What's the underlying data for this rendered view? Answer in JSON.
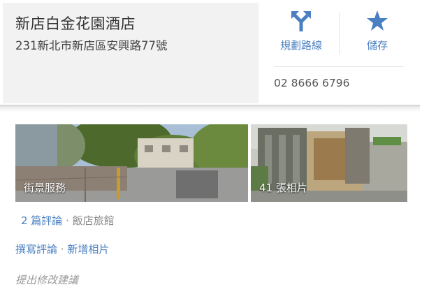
{
  "place": {
    "name": "新店白金花園酒店",
    "address": "231新北市新店區安興路77號",
    "phone": "02 8666 6796"
  },
  "actions": {
    "directions_label": "規劃路線",
    "save_label": "儲存"
  },
  "photos": {
    "streetview_label": "街景服務",
    "photos_label": "41 張相片"
  },
  "meta": {
    "reviews_link": "2 篇評論",
    "separator": " · ",
    "category": "飯店旅館"
  },
  "links": {
    "write_review": "撰寫評論",
    "add_photo": "新增相片",
    "suggest_edit": "提出修改建議"
  },
  "colors": {
    "accent": "#4a7fc1",
    "title_box_bg": "#f2f2f2"
  },
  "icons": {
    "directions": "directions-icon",
    "save": "star-icon"
  }
}
